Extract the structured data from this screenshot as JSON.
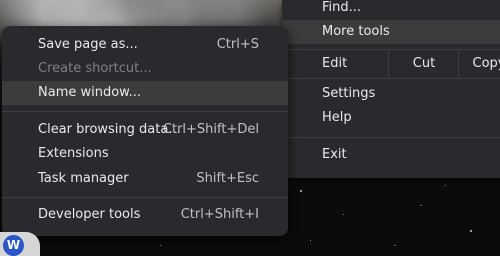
{
  "main_menu": {
    "find": "Find...",
    "more_tools": "More tools",
    "edit": "Edit",
    "cut": "Cut",
    "copy": "Copy",
    "settings": "Settings",
    "help": "Help",
    "exit": "Exit"
  },
  "more_tools_menu": {
    "items": [
      {
        "label": "Save page as...",
        "shortcut": "Ctrl+S"
      },
      {
        "label": "Create shortcut...",
        "shortcut": ""
      },
      {
        "label": "Name window...",
        "shortcut": ""
      },
      {
        "label": "Clear browsing data...",
        "shortcut": "Ctrl+Shift+Del"
      },
      {
        "label": "Extensions",
        "shortcut": ""
      },
      {
        "label": "Task manager",
        "shortcut": "Shift+Esc"
      },
      {
        "label": "Developer tools",
        "shortcut": "Ctrl+Shift+I"
      }
    ]
  },
  "profile": {
    "initial": "W"
  },
  "colors": {
    "menu_bg": "#292a2d",
    "highlight": "#3c3c3f",
    "text": "#e8eaed",
    "disabled": "#7d8085"
  }
}
